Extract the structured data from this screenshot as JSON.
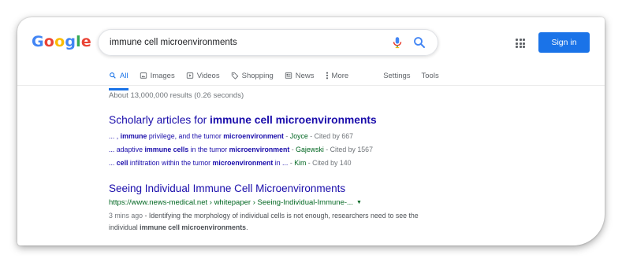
{
  "logo": {
    "g1": "G",
    "o1": "o",
    "o2": "o",
    "g2": "g",
    "l": "l",
    "e": "e"
  },
  "search": {
    "query": "immune cell microenvironments"
  },
  "header": {
    "signin_label": "Sign in"
  },
  "tabs": [
    {
      "label": "All",
      "icon": "search-icon"
    },
    {
      "label": "Images",
      "icon": "image-icon"
    },
    {
      "label": "Videos",
      "icon": "video-icon"
    },
    {
      "label": "Shopping",
      "icon": "tag-icon"
    },
    {
      "label": "News",
      "icon": "news-icon"
    },
    {
      "label": "More",
      "icon": "more-vert-icon"
    },
    {
      "label": "Settings"
    },
    {
      "label": "Tools"
    }
  ],
  "stats": "About 13,000,000 results (0.26 seconds)",
  "scholarly": {
    "title_prefix": "Scholarly articles for ",
    "title_bold": "immune cell microenvironments",
    "rows": [
      {
        "p1": "... , ",
        "b1": "immune",
        "p2": " privilege, and the tumor ",
        "b2": "microenvironment",
        "p3": "",
        "author": "Joyce",
        "cited": "Cited by 667"
      },
      {
        "p1": "... adaptive ",
        "b1": "immune cells",
        "p2": " in the tumor ",
        "b2": "microenvironment",
        "p3": "",
        "author": "Gajewski",
        "cited": "Cited by 1567"
      },
      {
        "p1": "... ",
        "b1": "cell",
        "p2": " infiltration within the tumor ",
        "b2": "microenvironment",
        "p3": " in ... ",
        "author": "Kim",
        "cited": "Cited by 140"
      }
    ]
  },
  "result": {
    "title": "Seeing Individual Immune Cell Microenvironments",
    "url": "https://www.news-medical.net › whitepaper › Seeing-Individual-Immune-...",
    "date": "3 mins ago",
    "snippet_a": " - Identifying the morphology of individual cells is not enough, researchers need to see the individual ",
    "snippet_bold": "immune cell microenvironments",
    "snippet_end": "."
  }
}
